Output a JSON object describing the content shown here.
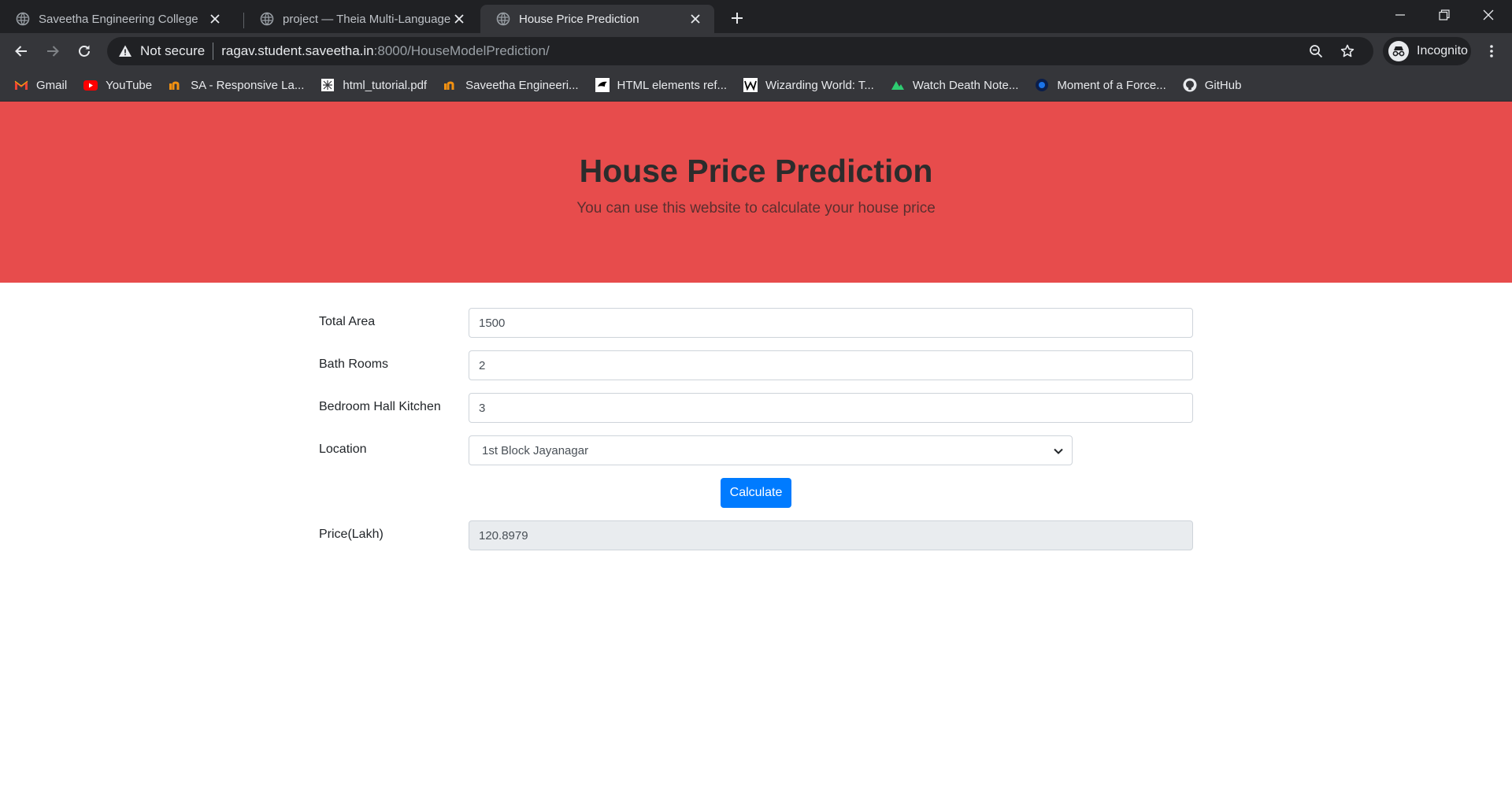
{
  "browser": {
    "tabs": [
      {
        "title": "Saveetha Engineering College",
        "active": false
      },
      {
        "title": "project — Theia Multi-Language",
        "active": false
      },
      {
        "title": "House Price Prediction",
        "active": true
      }
    ],
    "security_label": "Not secure",
    "url_host": "ragav.student.saveetha.in",
    "url_path": ":8000/HouseModelPrediction/",
    "profile_label": "Incognito",
    "bookmarks": [
      {
        "label": "Gmail",
        "icon": "gmail-icon"
      },
      {
        "label": "YouTube",
        "icon": "youtube-icon"
      },
      {
        "label": "SA - Responsive La...",
        "icon": "saveetha-icon"
      },
      {
        "label": "html_tutorial.pdf",
        "icon": "pdf-icon"
      },
      {
        "label": "Saveetha Engineeri...",
        "icon": "saveetha-icon"
      },
      {
        "label": "HTML elements ref...",
        "icon": "mdn-icon"
      },
      {
        "label": "Wizarding World: T...",
        "icon": "wizarding-icon"
      },
      {
        "label": "Watch Death Note...",
        "icon": "streaming-icon"
      },
      {
        "label": "Moment of a Force...",
        "icon": "moment-icon"
      },
      {
        "label": "GitHub",
        "icon": "github-icon"
      }
    ]
  },
  "header": {
    "title": "House Price Prediction",
    "lead": "You can use this website to calculate your house price",
    "background": "#e74c4c"
  },
  "form": {
    "total_area": {
      "label": "Total Area",
      "value": "1500"
    },
    "bath_rooms": {
      "label": "Bath Rooms",
      "value": "2"
    },
    "bhk": {
      "label": "Bedroom Hall Kitchen",
      "value": "3"
    },
    "location": {
      "label": "Location",
      "value": "1st Block Jayanagar"
    },
    "calculate_label": "Calculate",
    "price": {
      "label": "Price(Lakh)",
      "value": "120.8979"
    }
  }
}
